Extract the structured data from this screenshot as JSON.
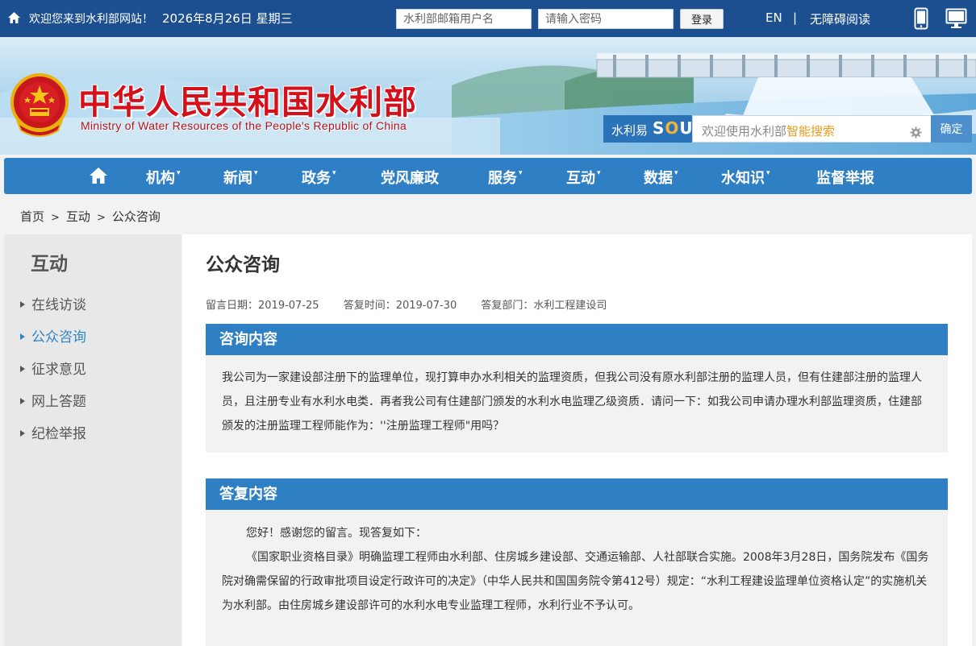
{
  "topbar": {
    "welcome": "欢迎您来到水利部网站！",
    "date": "2026年8月26日 星期三",
    "username_placeholder": "水利部邮箱用户名",
    "password_placeholder": "请输入密码",
    "login_label": "登录",
    "en_label": "EN",
    "separator": "|",
    "accessible_label": "无障碍阅读"
  },
  "banner": {
    "title": "中华人民共和国水利部",
    "subtitle": "Ministry of Water Resources of the People's Republic of China"
  },
  "search": {
    "brand_cn": "水利易",
    "brand_en_pre": "S",
    "brand_en_mid": "O",
    "brand_en_post": "U",
    "placeholder_pre": "欢迎使用水利部",
    "placeholder_highlight": "智能搜索",
    "submit_label": "确定"
  },
  "nav": {
    "items": [
      {
        "label": "机构",
        "caret": "▾"
      },
      {
        "label": "新闻",
        "caret": "▾"
      },
      {
        "label": "政务",
        "caret": "▾"
      },
      {
        "label": "党风廉政",
        "caret": ""
      },
      {
        "label": "服务",
        "caret": "▾"
      },
      {
        "label": "互动",
        "caret": "▾"
      },
      {
        "label": "数据",
        "caret": "▾"
      },
      {
        "label": "水知识",
        "caret": "▾"
      },
      {
        "label": "监督举报",
        "caret": ""
      }
    ]
  },
  "breadcrumb": {
    "home": "首页",
    "arrow": ">",
    "level1": "互动",
    "level2": "公众咨询"
  },
  "sidebar": {
    "title": "互动",
    "items": [
      {
        "label": "在线访谈"
      },
      {
        "label": "公众咨询"
      },
      {
        "label": "征求意见"
      },
      {
        "label": "网上答题"
      },
      {
        "label": "纪检举报"
      }
    ]
  },
  "main": {
    "title": "公众咨询",
    "meta": {
      "message_date": "留言日期：2019-07-25",
      "reply_date": "答复时间：2019-07-30",
      "department": "答复部门：水利工程建设司"
    },
    "question": {
      "heading": "咨询内容",
      "text": "我公司为一家建设部注册下的监理单位，现打算申办水利相关的监理资质，但我公司没有原水利部注册的监理人员，但有住建部注册的监理人员，且注册专业有水利水电类．再者我公司有住建部门颁发的水利水电监理乙级资质．请问一下：如我公司申请办理水利部监理资质，住建部颁发的注册监理工程师能作为：''注册监理工程师\"用吗？"
    },
    "answer": {
      "heading": "答复内容",
      "greeting": "您好！感谢您的留言。现答复如下：",
      "text": "《国家职业资格目录》明确监理工程师由水利部、住房城乡建设部、交通运输部、人社部联合实施。2008年3月28日，国务院发布《国务院对确需保留的行政审批项目设定行政许可的决定》（中华人民共和国国务院令第412号）规定：“水利工程建设监理单位资格认定”的实施机关为水利部。由住房城乡建设部许可的水利水电专业监理工程师，水利行业不予认可。"
    }
  },
  "colors": {
    "topbar": "#1b4f8f",
    "nav": "#2f7fc4",
    "title_red": "#d4111a",
    "active_link": "#2e84c8",
    "search_highlight": "#e89b1d"
  }
}
